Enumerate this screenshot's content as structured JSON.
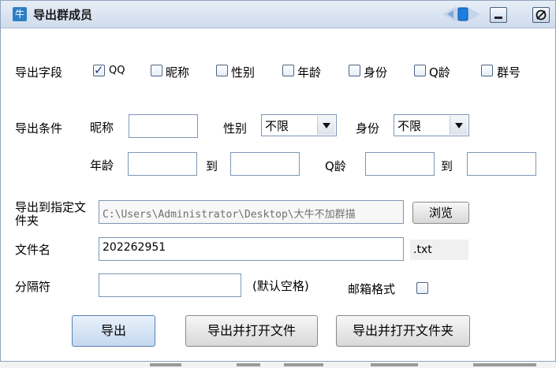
{
  "window": {
    "title": "导出群成员"
  },
  "titlebar": {
    "app_icon_char": "牛",
    "minimize_icon": "minimize-icon",
    "close_icon": "close-icon"
  },
  "fields": {
    "label": "导出字段",
    "options": [
      {
        "label": "QQ",
        "checked": true
      },
      {
        "label": "昵称",
        "checked": false
      },
      {
        "label": "性别",
        "checked": false
      },
      {
        "label": "年龄",
        "checked": false
      },
      {
        "label": "身份",
        "checked": false
      },
      {
        "label": "Q龄",
        "checked": false
      },
      {
        "label": "群号",
        "checked": false
      }
    ]
  },
  "conditions": {
    "label": "导出条件",
    "nickname_label": "昵称",
    "nickname_value": "",
    "gender_label": "性别",
    "gender_value": "不限",
    "identity_label": "身份",
    "identity_value": "不限",
    "age_label": "年龄",
    "age_from": "",
    "age_to_label": "到",
    "age_to": "",
    "qage_label": "Q龄",
    "qage_from": "",
    "qage_to_label": "到",
    "qage_to": ""
  },
  "export_path": {
    "label": "导出到指定文件夹",
    "value": "C:\\Users\\Administrator\\Desktop\\大牛不加群描",
    "browse_label": "浏览"
  },
  "filename": {
    "label": "文件名",
    "value": "202262951",
    "extension": ".txt"
  },
  "separator": {
    "label": "分隔符",
    "value": "",
    "hint": "(默认空格)"
  },
  "email_format": {
    "label": "邮箱格式",
    "checked": false
  },
  "buttons": {
    "export": "导出",
    "export_open_file": "导出并打开文件",
    "export_open_folder": "导出并打开文件夹"
  }
}
